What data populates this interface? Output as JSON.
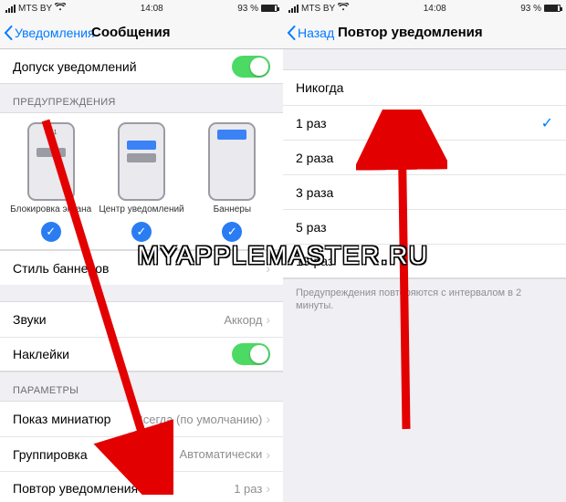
{
  "status": {
    "carrier": "MTS BY",
    "wifi_icon": "wifi",
    "time": "14:08",
    "battery_pct": "93 %"
  },
  "left": {
    "back_label": "Уведомления",
    "title": "Сообщения",
    "allow_label": "Допуск уведомлений",
    "warnings_header": "ПРЕДУПРЕЖДЕНИЯ",
    "previews": {
      "lock_time": "9:41",
      "lock_label": "Блокировка экрана",
      "center_label": "Центр уведомлений",
      "banner_label": "Баннеры"
    },
    "banner_style_label": "Стиль баннеров",
    "sounds_label": "Звуки",
    "sounds_value": "Аккорд",
    "stickers_label": "Наклейки",
    "params_header": "ПАРАМЕТРЫ",
    "thumbs_label": "Показ миниатюр",
    "thumbs_value": "Всегда (по умолчанию)",
    "grouping_label": "Группировка",
    "grouping_value": "Автоматически",
    "repeat_label": "Повтор уведомления",
    "repeat_value": "1 раз"
  },
  "right": {
    "back_label": "Назад",
    "title": "Повтор уведомления",
    "options": {
      "o0": "Никогда",
      "o1": "1 раз",
      "o2": "2 раза",
      "o3": "3 раза",
      "o4": "5 раз",
      "o5": "10 раз"
    },
    "selected_index": 1,
    "footer": "Предупреждения повторяются с интервалом в 2 минуты."
  },
  "watermark": "MYAPPLEMASTER.RU"
}
